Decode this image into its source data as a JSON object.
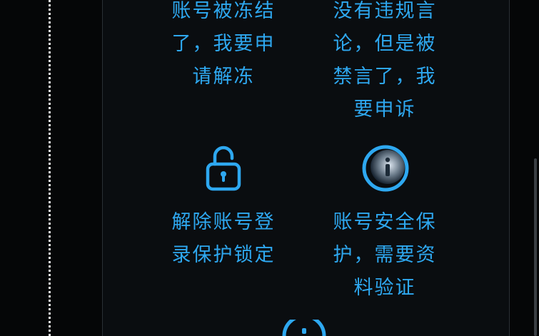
{
  "options": [
    {
      "lines": [
        "账号被冻结",
        "了，我要申",
        "请解冻"
      ],
      "icon": "none"
    },
    {
      "lines": [
        "没有违规言",
        "论，但是被",
        "禁言了，我",
        "要申诉"
      ],
      "icon": "none"
    },
    {
      "lines": [
        "解除账号登",
        "录保护锁定"
      ],
      "icon": "unlock-icon"
    },
    {
      "lines": [
        "账号安全保",
        "护，需要资",
        "料验证"
      ],
      "icon": "info-icon"
    }
  ],
  "colors": {
    "accent": "#2ea8f0",
    "background": "#050607",
    "panel": "#0a0d10"
  }
}
